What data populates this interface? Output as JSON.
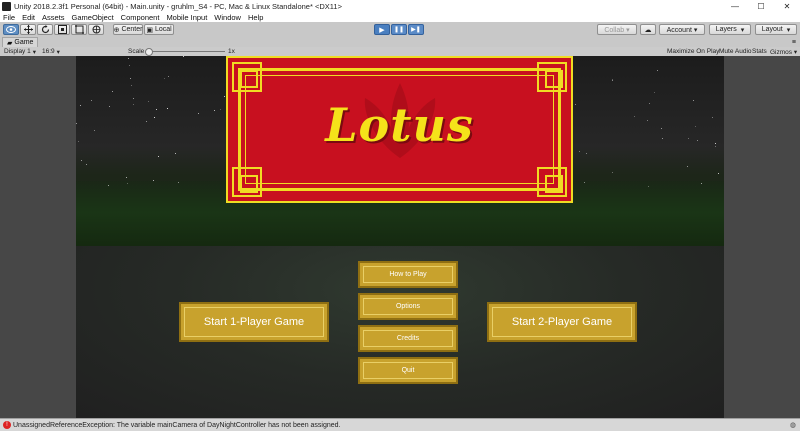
{
  "window": {
    "title": "Unity 2018.2.3f1 Personal (64bit) - Main.unity - gruhlm_S4 - PC, Mac & Linux Standalone* <DX11>",
    "controls": [
      "—",
      "☐",
      "✕"
    ]
  },
  "menu": [
    "File",
    "Edit",
    "Assets",
    "GameObject",
    "Component",
    "Mobile Input",
    "Window",
    "Help"
  ],
  "toolbar": {
    "tools": [
      "hand-tool",
      "move-tool",
      "rotate-tool",
      "scale-tool",
      "rect-tool",
      "transform-tool"
    ],
    "pivot_label": "Center",
    "space_label": "Local",
    "play_symbols": [
      "▶",
      "❚❚",
      "▶❚"
    ],
    "collab_label": "Collab ▾",
    "cloud_symbol": "☁",
    "account_label": "Account ▾",
    "layers_label": "Layers",
    "layout_label": "Layout"
  },
  "game_view": {
    "tab_label": "Game",
    "display_label": "Display 1",
    "aspect_label": "16:9",
    "scale_label": "Scale",
    "scale_value": "1x",
    "options": [
      "Maximize On Play",
      "Mute Audio",
      "Stats",
      "Gizmos ▾"
    ]
  },
  "game": {
    "logo_title": "Lotus",
    "buttons": {
      "how_to_play": "How to Play",
      "options": "Options",
      "credits": "Credits",
      "quit": "Quit",
      "start_1p": "Start 1-Player Game",
      "start_2p": "Start 2-Player Game"
    }
  },
  "status": {
    "message": "UnassignedReferenceException: The variable mainCamera of DayNightController has not been assigned."
  },
  "colors": {
    "banner_red": "#c8101f",
    "banner_gold": "#f0dc23",
    "button_gold": "#c8a22d",
    "error_red": "#dd2222",
    "play_blue": "#4a7fc0"
  }
}
